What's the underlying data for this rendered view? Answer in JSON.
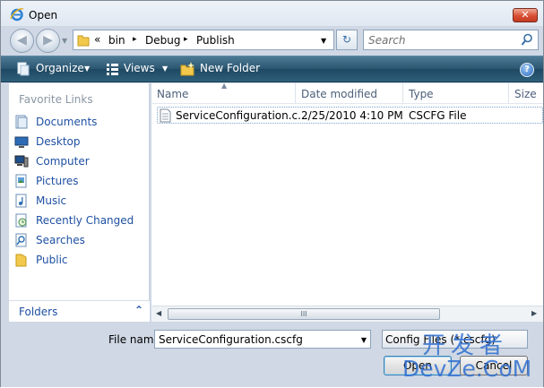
{
  "window": {
    "title": "Open",
    "close_glyph": "✕"
  },
  "nav": {
    "back_glyph": "◀",
    "forward_glyph": "▶",
    "address_prefix": "«",
    "breadcrumbs": [
      "bin",
      "Debug",
      "Publish"
    ],
    "separator": "▸",
    "refresh_glyph": "↻",
    "search_placeholder": "Search"
  },
  "toolbar": {
    "organize": "Organize",
    "views": "Views",
    "new_folder": "New Folder",
    "help": "?"
  },
  "sidebar": {
    "favorites_title": "Favorite Links",
    "items": [
      {
        "label": "Documents",
        "icon": "documents-icon"
      },
      {
        "label": "Desktop",
        "icon": "desktop-icon"
      },
      {
        "label": "Computer",
        "icon": "computer-icon"
      },
      {
        "label": "Pictures",
        "icon": "pictures-icon"
      },
      {
        "label": "Music",
        "icon": "music-icon"
      },
      {
        "label": "Recently Changed",
        "icon": "recent-icon"
      },
      {
        "label": "Searches",
        "icon": "searches-icon"
      },
      {
        "label": "Public",
        "icon": "public-icon"
      }
    ],
    "folders_label": "Folders",
    "folders_chevron": "⌃"
  },
  "files": {
    "columns": [
      "Name",
      "Date modified",
      "Type",
      "Size"
    ],
    "rows": [
      {
        "name": "ServiceConfiguration.c...",
        "date": "2/25/2010 4:10 PM",
        "type": "CSCFG File",
        "size": ""
      }
    ]
  },
  "scrollbar": {
    "left": "◀",
    "right": "▶",
    "grip": "III"
  },
  "dialog": {
    "filename_label": "File name:",
    "filename_value": "ServiceConfiguration.cscfg",
    "filter_value": "Config Files (*.cscfg)",
    "open_label": "Open",
    "cancel_label": "Cancel"
  },
  "watermark": {
    "top": "开发者",
    "bottom": "DevZe.CoM"
  },
  "colors": {
    "toolbar": "#2a5570",
    "link": "#1e50a2",
    "close": "#d84f34"
  }
}
